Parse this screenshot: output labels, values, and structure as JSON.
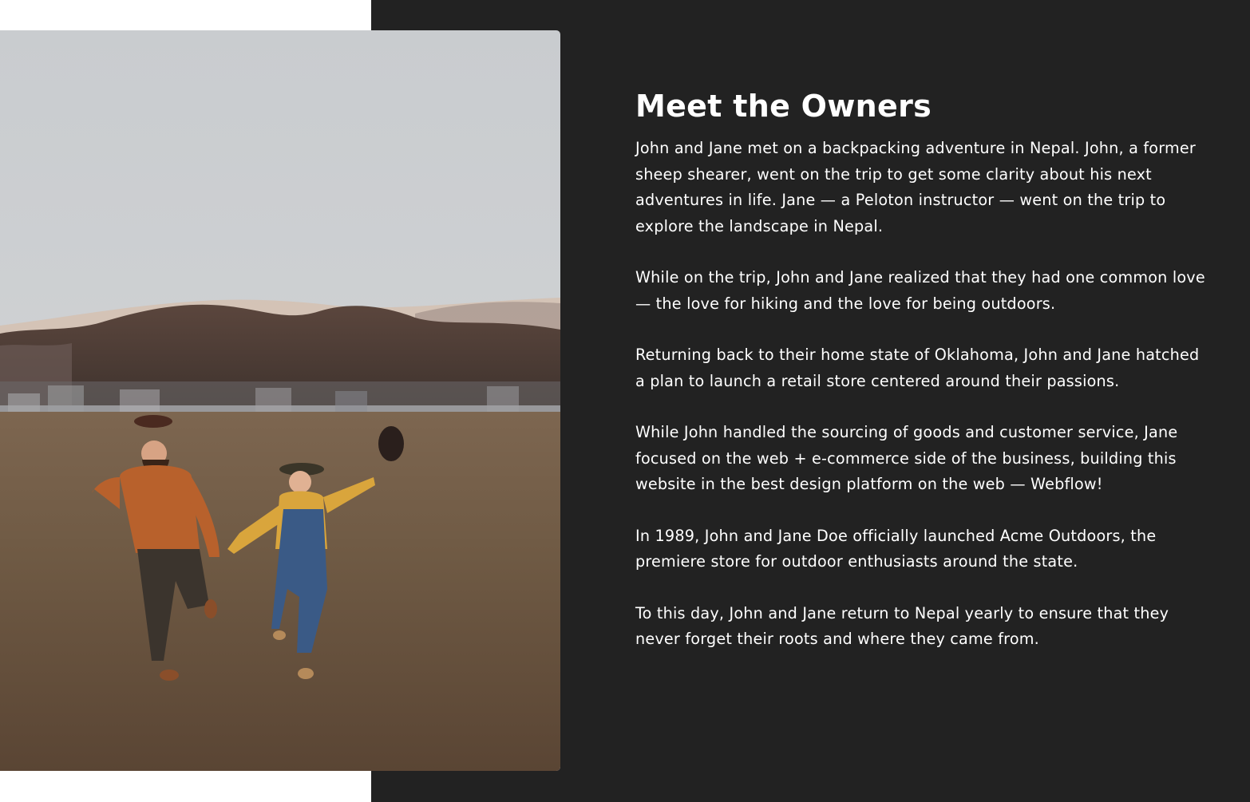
{
  "section": {
    "heading": "Meet the Owners",
    "paragraphs": [
      "John and Jane met on a backpacking adventure in Nepal. John, a former sheep shearer, went on the trip to get some clarity about his next adventures in life. Jane — a Peloton instructor — went on the trip to explore the landscape in Nepal.",
      "While on the trip, John and Jane realized that they had one common love — the love for hiking and the love for being outdoors.",
      "Returning back to their home state of Oklahoma, John and Jane hatched a plan to launch a retail store centered around their passions.",
      "While John handled the sourcing of goods and customer service, Jane focused on the web + e-commerce side of the business, building this website in the best design platform on the web — Webflow!",
      "In 1989, John and Jane Doe officially launched Acme Outdoors, the premiere store for outdoor enthusiasts around the state.",
      "To this day, John and Jane return to Nepal yearly to ensure that they never forget their roots and where they came from."
    ]
  },
  "colors": {
    "panel_background": "#222222",
    "page_background": "#ffffff",
    "text": "#ffffff"
  },
  "image": {
    "subject": "couple-running-in-field-photo"
  }
}
